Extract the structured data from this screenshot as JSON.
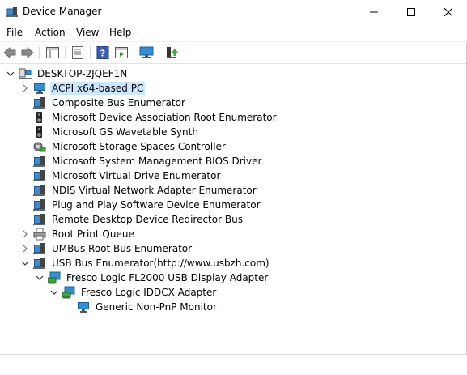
{
  "window": {
    "title": "Device Manager",
    "controls": [
      "minimize",
      "maximize",
      "close"
    ]
  },
  "menu": {
    "items": [
      {
        "label": "File"
      },
      {
        "label": "Action"
      },
      {
        "label": "View"
      },
      {
        "label": "Help"
      }
    ]
  },
  "toolbar": {
    "buttons": [
      {
        "icon": "back-arrow-icon"
      },
      {
        "icon": "forward-arrow-icon"
      },
      {
        "icon": "properties-console-icon"
      },
      {
        "icon": "list-view-icon"
      },
      {
        "icon": "help-icon"
      },
      {
        "icon": "action-pane-icon"
      },
      {
        "icon": "scan-hardware-icon"
      },
      {
        "icon": "update-driver-icon"
      }
    ]
  },
  "tree": {
    "root": {
      "label": "DESKTOP-2JQEF1N",
      "expanded": true
    },
    "items": [
      {
        "label": "ACPI x64-based PC",
        "icon": "monitor-icon",
        "expander": "collapsed",
        "selected": true,
        "depth": 1
      },
      {
        "label": "Composite Bus Enumerator",
        "icon": "system-device-icon",
        "expander": "none",
        "depth": 1
      },
      {
        "label": "Microsoft Device Association Root Enumerator",
        "icon": "speaker-icon",
        "expander": "none",
        "depth": 1
      },
      {
        "label": "Microsoft GS Wavetable Synth",
        "icon": "speaker-icon",
        "expander": "none",
        "depth": 1
      },
      {
        "label": "Microsoft Storage Spaces Controller",
        "icon": "storage-controller-icon",
        "expander": "none",
        "depth": 1
      },
      {
        "label": "Microsoft System Management BIOS Driver",
        "icon": "system-device-icon",
        "expander": "none",
        "depth": 1
      },
      {
        "label": "Microsoft Virtual Drive Enumerator",
        "icon": "system-device-icon",
        "expander": "none",
        "depth": 1
      },
      {
        "label": "NDIS Virtual Network Adapter Enumerator",
        "icon": "system-device-icon",
        "expander": "none",
        "depth": 1
      },
      {
        "label": "Plug and Play Software Device Enumerator",
        "icon": "system-device-icon",
        "expander": "none",
        "depth": 1
      },
      {
        "label": "Remote Desktop Device Redirector Bus",
        "icon": "system-device-icon",
        "expander": "none",
        "depth": 1
      },
      {
        "label": "Root Print Queue",
        "icon": "printer-icon",
        "expander": "collapsed",
        "depth": 1
      },
      {
        "label": "UMBus Root Bus Enumerator",
        "icon": "system-device-icon",
        "expander": "collapsed",
        "depth": 1
      },
      {
        "label": "USB Bus Enumerator(http://www.usbzh.com)",
        "icon": "system-device-icon",
        "expander": "expanded",
        "depth": 1
      },
      {
        "label": "Fresco Logic FL2000 USB Display Adapter",
        "icon": "display-adapter-icon",
        "expander": "expanded",
        "depth": 2
      },
      {
        "label": "Fresco Logic IDDCX Adapter",
        "icon": "display-adapter-icon",
        "expander": "expanded",
        "depth": 3
      },
      {
        "label": "Generic Non-PnP Monitor",
        "icon": "monitor-icon",
        "expander": "none",
        "depth": 4
      }
    ]
  },
  "colors": {
    "selection": "#cce8ff",
    "device_blue": "#2f8fd8",
    "separator": "#d9d9d9"
  }
}
